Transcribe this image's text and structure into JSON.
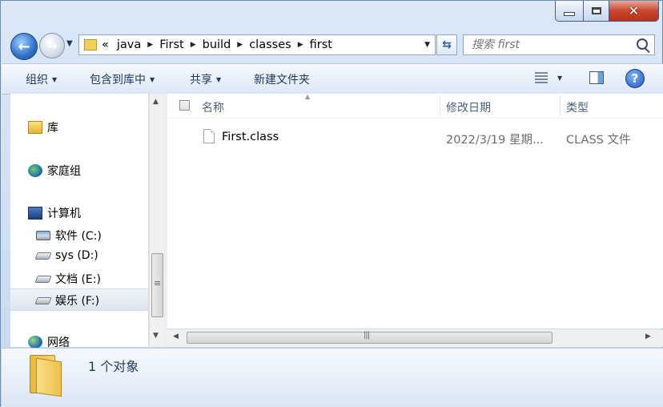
{
  "window": {
    "controls": {
      "minimize": "",
      "maximize": "",
      "close": "✕"
    }
  },
  "nav": {
    "back_icon": "←",
    "forward_icon": "→",
    "history_caret": "▼"
  },
  "address": {
    "overflow": "«",
    "crumbs": [
      "java",
      "First",
      "build",
      "classes",
      "first"
    ],
    "separator": "▶",
    "dropdown": "▼"
  },
  "search": {
    "placeholder": "搜索 first"
  },
  "toolbar": {
    "organize": "组织",
    "include_library": "包含到库中",
    "share": "共享",
    "new_folder": "新建文件夹",
    "caret": "▼",
    "help": "?"
  },
  "sidebar": {
    "library": "库",
    "homegroup": "家庭组",
    "computer": "计算机",
    "drives": [
      "软件 (C:)",
      "sys (D:)",
      "文档 (E:)",
      "娱乐 (F:)"
    ],
    "network": "网络"
  },
  "columns": {
    "name": "名称",
    "date": "修改日期",
    "type": "类型"
  },
  "files": [
    {
      "name": "First.class",
      "date": "2022/3/19 星期...",
      "type": "CLASS 文件"
    }
  ],
  "details": {
    "status": "1 个对象"
  }
}
